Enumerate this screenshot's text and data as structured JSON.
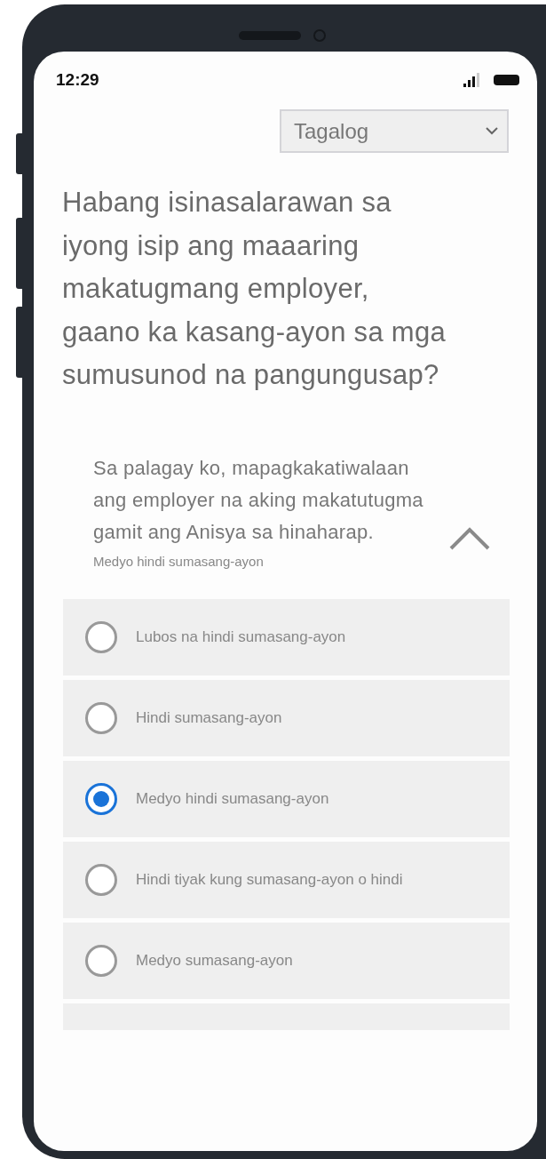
{
  "status_bar": {
    "time": "12:29"
  },
  "language_select": {
    "value": "Tagalog"
  },
  "question": "Habang isinasalarawan sa iyong isip ang maaaring makatugmang employer, gaano ka kasang-ayon sa mga sumusunod na pangungusap?",
  "statement": {
    "text": "Sa palagay ko, mapagkakatiwalaan ang employer na aking makatutugma gamit ang Anisya sa hinaharap.",
    "answer": "Medyo hindi sumasang-ayon",
    "expanded": true
  },
  "options": [
    {
      "label": "Lubos na hindi sumasang-ayon",
      "selected": false
    },
    {
      "label": "Hindi sumasang-ayon",
      "selected": false
    },
    {
      "label": "Medyo hindi sumasang-ayon",
      "selected": true
    },
    {
      "label": "Hindi tiyak kung sumasang-ayon o hindi",
      "selected": false
    },
    {
      "label": "Medyo sumasang-ayon",
      "selected": false
    }
  ]
}
